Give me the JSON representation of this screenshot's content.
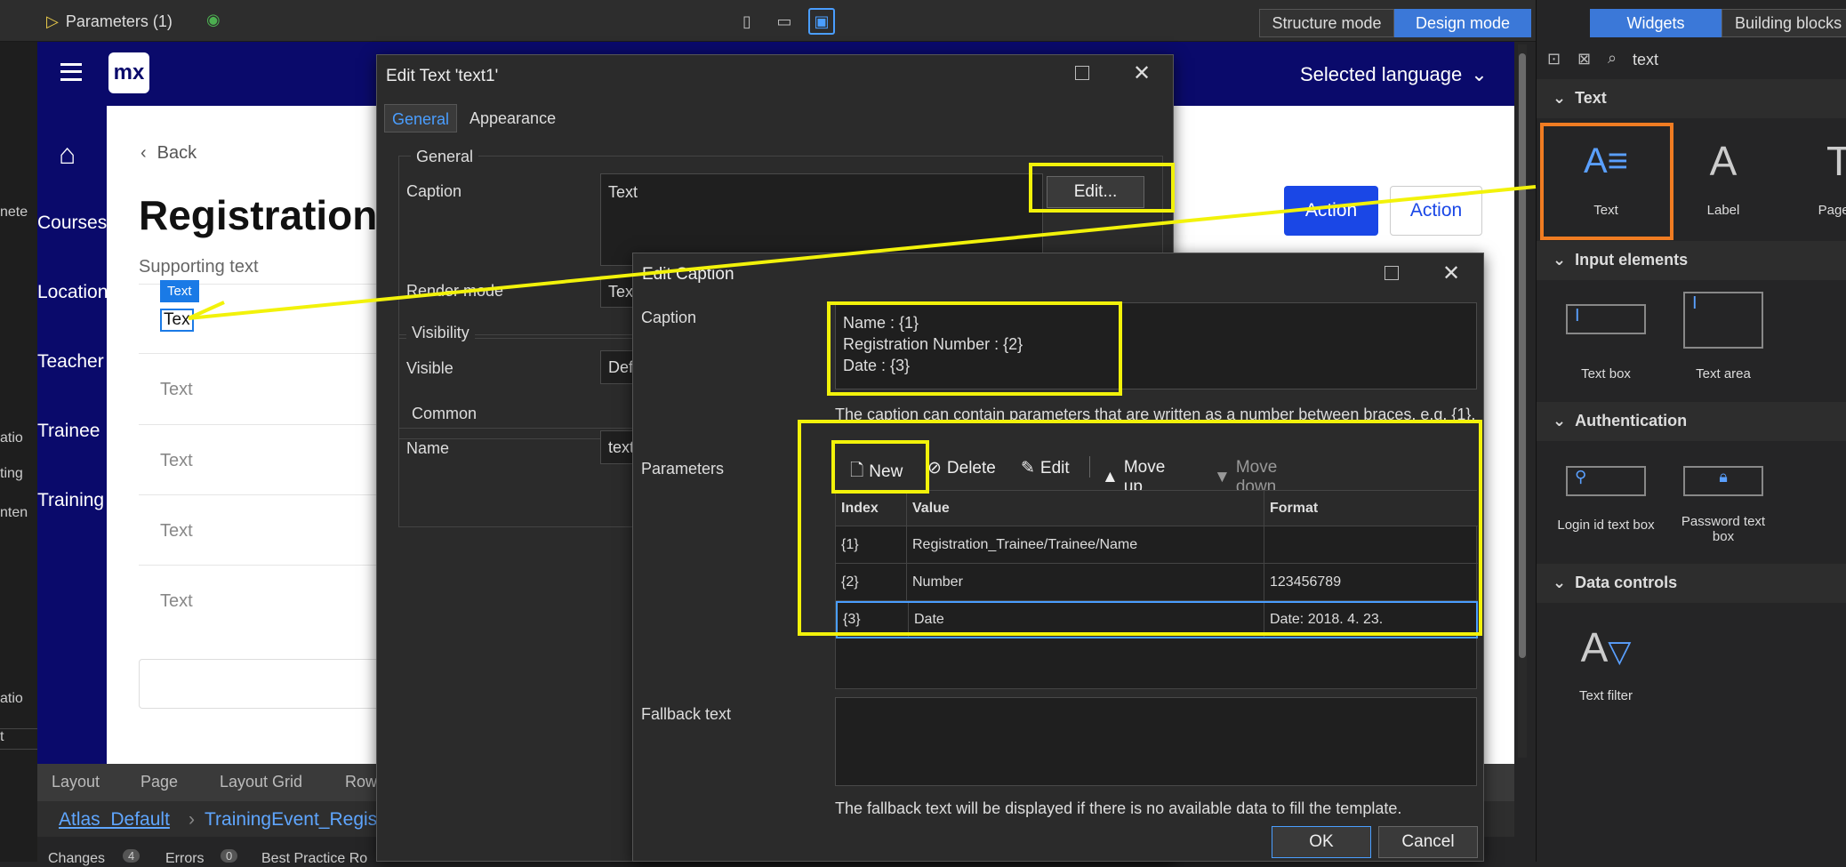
{
  "topbar": {
    "tab": "Parameters (1)",
    "structure_mode": "Structure mode",
    "design_mode": "Design mode"
  },
  "left_fragments": [
    "nete",
    "atio",
    "ting",
    "nten",
    "atio",
    "t"
  ],
  "app": {
    "logo": "mx",
    "language": "Selected language",
    "back": "Back",
    "title": "Registration",
    "supporting": "Supporting text",
    "action_primary": "Action",
    "action_secondary": "Action",
    "nav": [
      "Courses",
      "Location",
      "Teacher",
      "Trainee",
      "Training"
    ],
    "selected_label": "Text",
    "selected_text": "Tex",
    "rows": [
      "Text",
      "Text",
      "Text",
      "Text"
    ]
  },
  "breadcrumb": [
    "Layout",
    "Page",
    "Layout Grid",
    "Row"
  ],
  "path": {
    "module": "Atlas_Default",
    "page": "TrainingEvent_Regist"
  },
  "statusbar": {
    "changes": "Changes",
    "changes_count": "4",
    "errors": "Errors",
    "errors_count": "0",
    "best": "Best Practice Ro"
  },
  "right": {
    "tab_widgets": "Widgets",
    "tab_blocks": "Building blocks",
    "search": "text",
    "sections": [
      {
        "title": "Text",
        "items": [
          "Text",
          "Label",
          "Page ti"
        ]
      },
      {
        "title": "Input elements",
        "items": [
          "Text box",
          "Text area"
        ]
      },
      {
        "title": "Authentication",
        "items": [
          "Login id text box",
          "Password text box"
        ]
      },
      {
        "title": "Data controls",
        "items": [
          "Text filter"
        ]
      }
    ]
  },
  "edit_text": {
    "title": "Edit Text 'text1'",
    "tab_general": "General",
    "tab_appearance": "Appearance",
    "group_general": "General",
    "caption_label": "Caption",
    "caption_value": "Text",
    "edit_btn": "Edit...",
    "render_label": "Render mode",
    "render_value": "Tex",
    "visibility_group": "Visibility",
    "visible_label": "Visible",
    "visible_value": "Def",
    "common_group": "Common",
    "name_label": "Name",
    "name_value": "text"
  },
  "edit_caption": {
    "title": "Edit Caption",
    "caption_label": "Caption",
    "caption_lines": [
      "Name : {1}",
      "Registration Number : {2}",
      "Date : {3}"
    ],
    "hint": "The caption can contain parameters that are written as a number between braces, e.g. {1}.",
    "params_label": "Parameters",
    "toolbar": {
      "new": "New",
      "delete": "Delete",
      "edit": "Edit",
      "up": "Move up",
      "down": "Move down"
    },
    "columns": [
      "Index",
      "Value",
      "Format"
    ],
    "rows": [
      [
        "{1}",
        "Registration_Trainee/Trainee/Name",
        ""
      ],
      [
        "{2}",
        "Number",
        "123456789"
      ],
      [
        "{3}",
        "Date",
        "Date: 2018. 4. 23."
      ]
    ],
    "fallback_label": "Fallback text",
    "fallback_hint": "The fallback text will be displayed if there is no available data to fill the template.",
    "ok": "OK",
    "cancel": "Cancel"
  },
  "colors": {
    "highlight": "#f2f20a",
    "accent": "#4a9eff",
    "brand": "#0a0a6b",
    "primary_button": "#1a47e6",
    "orange_outline": "#f07c22"
  }
}
